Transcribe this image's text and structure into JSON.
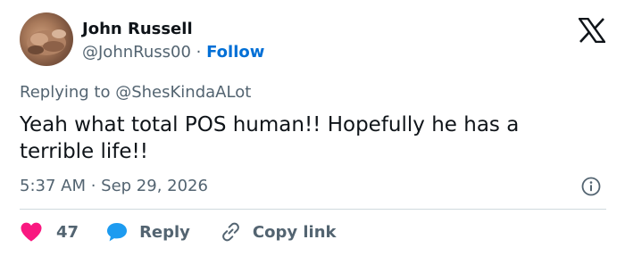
{
  "author": {
    "name": "John Russell",
    "handle": "@JohnRuss00",
    "separator": "·",
    "follow_label": "Follow"
  },
  "brand": {
    "icon": "x-logo-icon"
  },
  "reply_context": {
    "prefix": "Replying to",
    "mention": "@ShesKindaALot"
  },
  "tweet": {
    "text": "Yeah what total POS human!! Hopefully he has a terrible life!!",
    "timestamp": "5:37 AM · Sep 29, 2026"
  },
  "actions": {
    "like": {
      "icon": "heart-icon",
      "count": "47",
      "color": "#f91880"
    },
    "reply": {
      "icon": "reply-bubble-icon",
      "label": "Reply",
      "color": "#1d9bf0"
    },
    "copy_link": {
      "icon": "link-icon",
      "label": "Copy link"
    }
  },
  "colors": {
    "text_primary": "#0f1419",
    "text_secondary": "#536471",
    "link": "#006fd6",
    "divider": "#cfd9de"
  }
}
